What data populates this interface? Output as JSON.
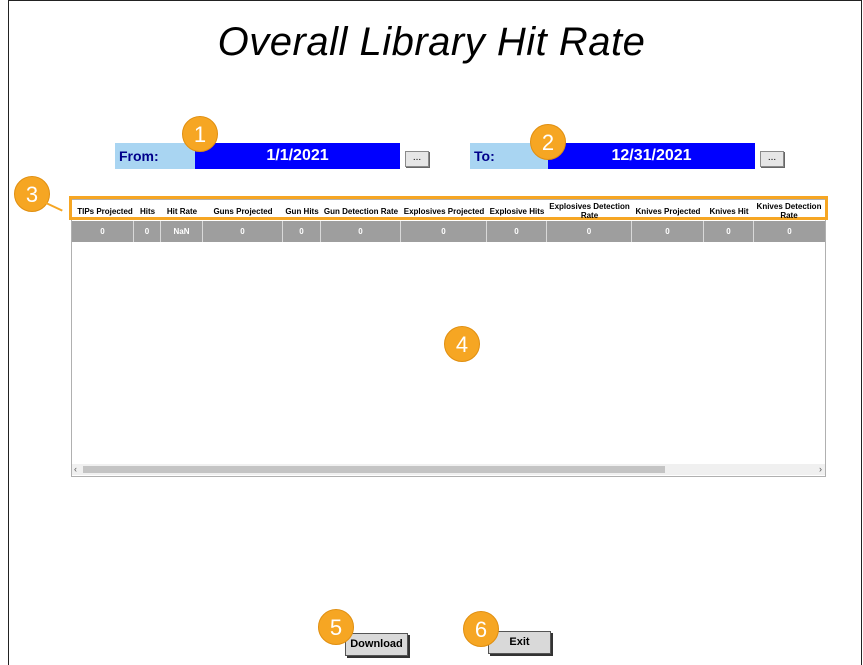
{
  "page": {
    "title": "Overall Library Hit Rate"
  },
  "from": {
    "label": "From:",
    "value": "1/1/2021",
    "picker_label": "..."
  },
  "to": {
    "label": "To:",
    "value": "12/31/2021",
    "picker_label": "..."
  },
  "grid": {
    "columns": [
      "TIPs Projected",
      "Hits",
      "Hit Rate",
      "Guns Projected",
      "Gun Hits",
      "Gun Detection Rate",
      "Explosives Projected",
      "Explosive Hits",
      "Explosives Detection Rate",
      "Knives Projected",
      "Knives Hit",
      "Knives Detection Rate"
    ],
    "rows": [
      [
        "0",
        "0",
        "NaN",
        "0",
        "0",
        "0",
        "0",
        "0",
        "0",
        "0",
        "0",
        "0"
      ]
    ],
    "scroll_left": "‹",
    "scroll_right": "›"
  },
  "actions": {
    "download_label": "Download",
    "exit_label": "Exit"
  },
  "badges": [
    "1",
    "2",
    "3",
    "4",
    "5",
    "6"
  ],
  "colors": {
    "badge": "#f6a623",
    "date_value_bg": "#0000ff",
    "date_label_bg": "#a9d5f2"
  }
}
